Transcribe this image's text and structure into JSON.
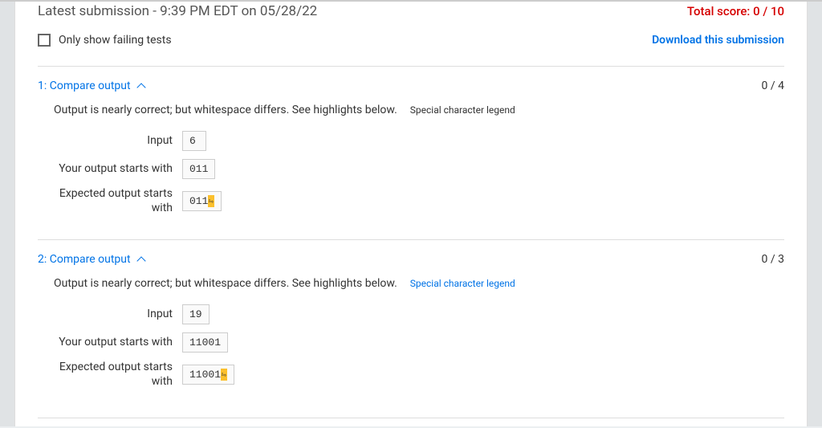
{
  "header": {
    "submission_label": "Latest submission - 9:39 PM EDT on 05/28/22",
    "total_score_label": "Total score: 0 / 10"
  },
  "filter": {
    "checkbox_label": "Only show failing tests",
    "download_label": "Download this submission"
  },
  "labels": {
    "compare_output": "Compare output",
    "input": "Input",
    "your_output": "Your output starts with",
    "expected_output": "Expected output starts with",
    "legend": "Special character legend"
  },
  "tests": [
    {
      "index": "1",
      "score": "0 / 4",
      "message": "Output is nearly correct; but whitespace differs. See highlights below.",
      "legend_blue": false,
      "input": "6",
      "your_output": "011",
      "expected_output": "011"
    },
    {
      "index": "2",
      "score": "0 / 3",
      "message": "Output is nearly correct; but whitespace differs. See highlights below.",
      "legend_blue": true,
      "input": "19",
      "your_output": "11001",
      "expected_output": "11001"
    }
  ]
}
